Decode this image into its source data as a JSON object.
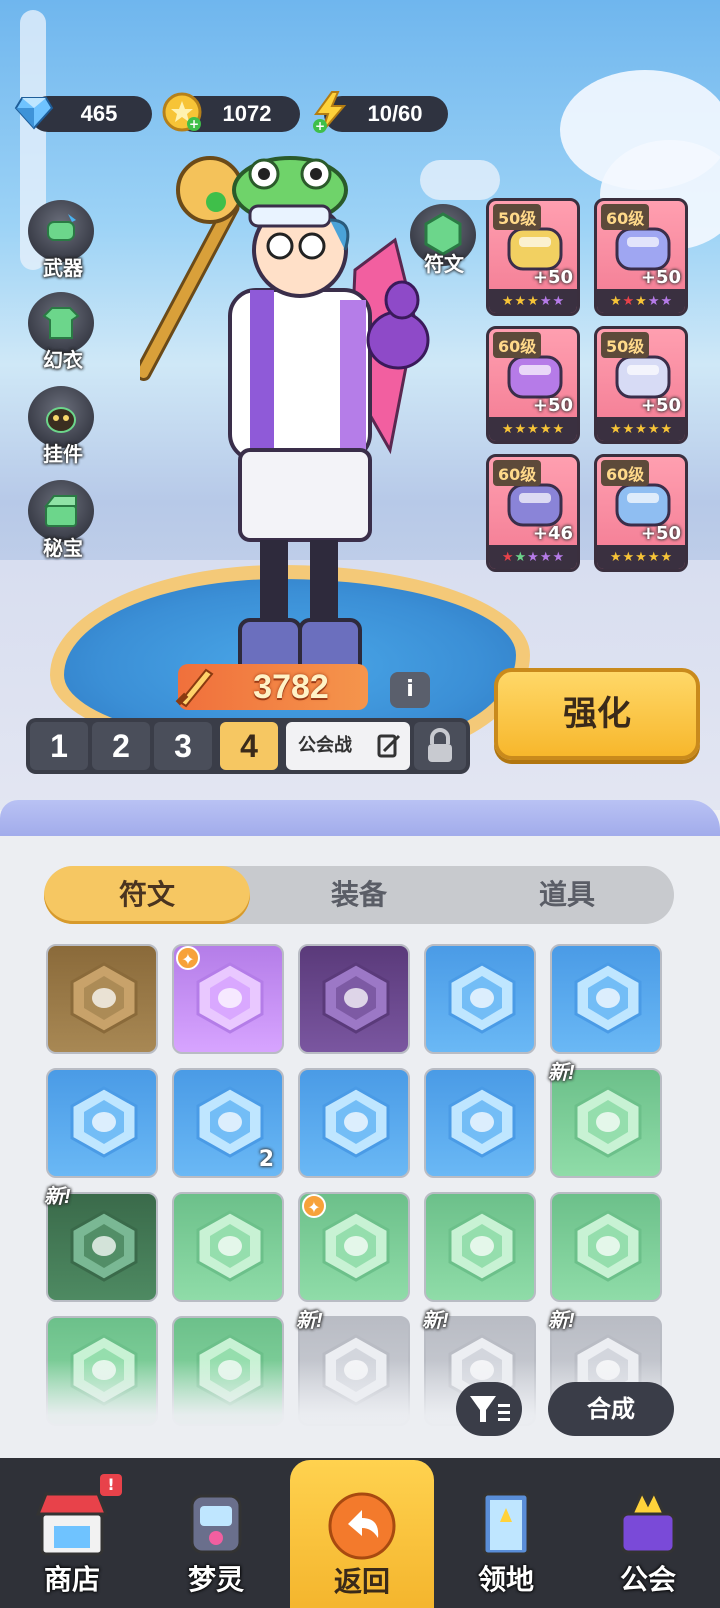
{
  "currencies": {
    "diamonds": "465",
    "gold": "1072",
    "energy": "10/60"
  },
  "side_menu": [
    {
      "label": "武器",
      "icon": "weapon-icon"
    },
    {
      "label": "幻衣",
      "icon": "costume-icon"
    },
    {
      "label": "挂件",
      "icon": "pendant-icon"
    },
    {
      "label": "秘宝",
      "icon": "treasure-icon"
    }
  ],
  "rune_button": {
    "label": "符文"
  },
  "equipment": [
    {
      "level": "50级",
      "plus": "+50",
      "item": "helmet"
    },
    {
      "level": "60级",
      "plus": "+50",
      "item": "jacket"
    },
    {
      "level": "60级",
      "plus": "+50",
      "item": "bracer"
    },
    {
      "level": "50级",
      "plus": "+50",
      "item": "shorts"
    },
    {
      "level": "60级",
      "plus": "+46",
      "item": "shoes"
    },
    {
      "level": "60级",
      "plus": "+50",
      "item": "gadget"
    }
  ],
  "power": {
    "value": "3782",
    "info": "i"
  },
  "enhance_button": "强化",
  "loadout_slots": [
    "1",
    "2",
    "3",
    "4"
  ],
  "active_slot": "4",
  "guild_war_label": "公会战",
  "tabs": [
    {
      "label": "符文",
      "active": true
    },
    {
      "label": "装备",
      "active": false
    },
    {
      "label": "道具",
      "active": false
    }
  ],
  "rune_grid": [
    {
      "rarity": "brown",
      "icon": "helmet-rune-icon",
      "new": false,
      "count": ""
    },
    {
      "rarity": "purple",
      "icon": "shoe-rune-icon",
      "new": false,
      "count": "",
      "star": true
    },
    {
      "rarity": "dark-purple",
      "icon": "glove-rune-icon",
      "new": false,
      "count": ""
    },
    {
      "rarity": "blue",
      "icon": "helmet-rune-icon",
      "new": false,
      "count": ""
    },
    {
      "rarity": "blue",
      "icon": "helmet-rune-icon",
      "new": false,
      "count": ""
    },
    {
      "rarity": "blue",
      "icon": "shorts-rune-icon",
      "new": false,
      "count": ""
    },
    {
      "rarity": "blue",
      "icon": "shoe-rune-icon",
      "new": false,
      "count": "2"
    },
    {
      "rarity": "blue",
      "icon": "shoe-rune-icon",
      "new": false,
      "count": ""
    },
    {
      "rarity": "blue",
      "icon": "glove-rune-icon",
      "new": false,
      "count": ""
    },
    {
      "rarity": "green",
      "icon": "jacket-rune-icon",
      "new": true,
      "count": ""
    },
    {
      "rarity": "dark-green",
      "icon": "jacket-rune-icon",
      "new": true,
      "count": ""
    },
    {
      "rarity": "green",
      "icon": "helmet-rune-icon",
      "new": false,
      "count": ""
    },
    {
      "rarity": "green",
      "icon": "gadget-rune-icon",
      "new": false,
      "count": "",
      "star": true
    },
    {
      "rarity": "green",
      "icon": "bracer-rune-icon",
      "new": false,
      "count": ""
    },
    {
      "rarity": "green",
      "icon": "jacket-rune-icon",
      "new": false,
      "count": ""
    },
    {
      "rarity": "green",
      "icon": "jacket-rune-icon",
      "new": false,
      "count": ""
    },
    {
      "rarity": "green",
      "icon": "jacket-rune-icon",
      "new": false,
      "count": ""
    },
    {
      "rarity": "grey",
      "icon": "rune-icon",
      "new": true,
      "count": ""
    },
    {
      "rarity": "grey",
      "icon": "rune-icon",
      "new": true,
      "count": ""
    },
    {
      "rarity": "grey",
      "icon": "rune-icon",
      "new": true,
      "count": ""
    }
  ],
  "new_tag": "新!",
  "compose_button": "合成",
  "bottom_nav": [
    {
      "label": "商店",
      "icon": "shop-icon",
      "badge": "!"
    },
    {
      "label": "梦灵",
      "icon": "spirit-icon"
    },
    {
      "label": "返回",
      "icon": "back-arrow-icon",
      "active": true
    },
    {
      "label": "领地",
      "icon": "territory-icon"
    },
    {
      "label": "公会",
      "icon": "guild-icon"
    }
  ],
  "colors": {
    "accent": "#f6c762",
    "rarity_blue": "#4a9be6",
    "rarity_green": "#6cc08a",
    "rarity_purple": "#a870e0",
    "rarity_brown": "#8a6a3a"
  }
}
